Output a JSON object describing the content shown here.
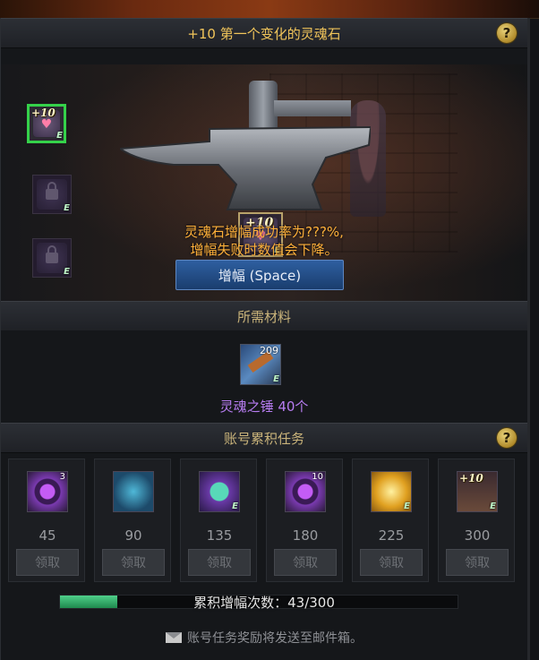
{
  "header": {
    "title": "+10 第一个变化的灵魂石",
    "help_label": "?"
  },
  "forge": {
    "slots": [
      {
        "badge": "+10",
        "tag": "E",
        "state": "active"
      },
      {
        "badge": "",
        "tag": "E",
        "state": "locked"
      },
      {
        "badge": "",
        "tag": "E",
        "state": "locked"
      }
    ],
    "center_item": {
      "badge": "+10",
      "tag": "E"
    },
    "message_line1": "灵魂石增幅成功率为???%,",
    "message_line2": "增幅失败时数值会下降。",
    "amplify_button_label": "增幅 (Space)"
  },
  "materials": {
    "title": "所需材料",
    "item": {
      "count": "209",
      "tag": "E",
      "label": "灵魂之锤 40个"
    }
  },
  "tasks": {
    "title": "账号累积任务",
    "help_label": "?",
    "items": [
      {
        "icon": "purple-orb-icon",
        "count": "3",
        "tag": "",
        "value": "45",
        "claim_label": "领取"
      },
      {
        "icon": "blue-bag-icon",
        "count": "",
        "tag": "",
        "value": "90",
        "claim_label": "领取"
      },
      {
        "icon": "soul-gem-icon",
        "count": "",
        "tag": "E",
        "value": "135",
        "claim_label": "领取"
      },
      {
        "icon": "purple-orb-icon",
        "count": "10",
        "tag": "",
        "value": "180",
        "claim_label": "领取"
      },
      {
        "icon": "gold-box-icon",
        "count": "",
        "tag": "E",
        "value": "225",
        "claim_label": "领取"
      },
      {
        "icon": "plus10-scroll-icon",
        "count": "",
        "tag": "E",
        "badge": "+10",
        "value": "300",
        "claim_label": "领取"
      }
    ],
    "progress": {
      "label": "累积增幅次数：43/300",
      "current": 43,
      "max": 300
    },
    "footer_note": "账号任务奖励将发送至邮件箱。"
  },
  "colors": {
    "active_slot_border": "#35d24a",
    "warning_text": "#ffb13a",
    "material_label": "#b67cf0",
    "progress_fill": "#2fb06a",
    "button_blue": "#2e5fa0"
  }
}
